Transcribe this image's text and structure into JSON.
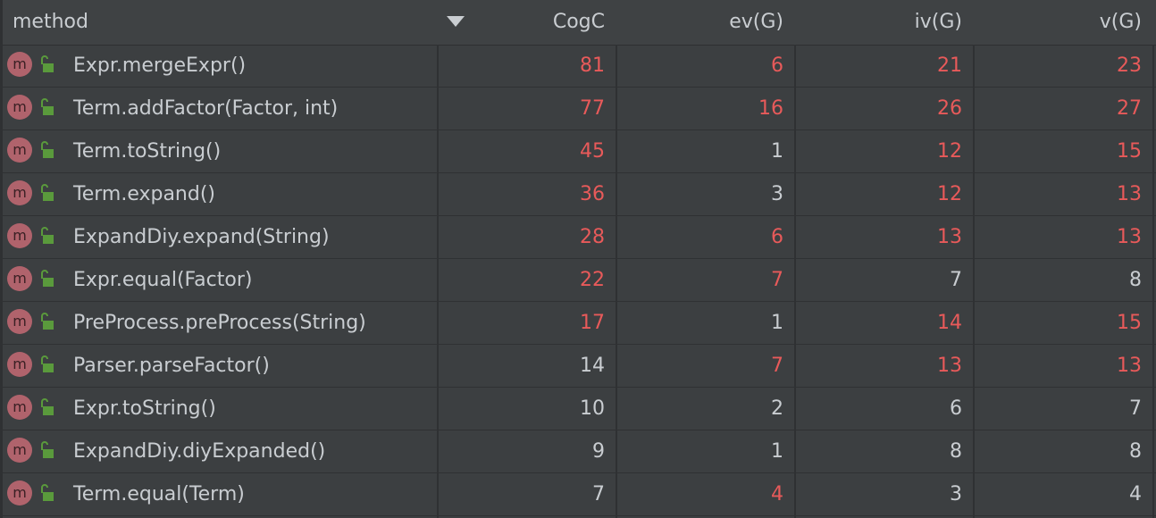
{
  "columns": {
    "method": "method",
    "cogc": "CogC",
    "evg": "ev(G)",
    "ivg": "iv(G)",
    "vg": "v(G)"
  },
  "colors": {
    "highlight": "#e85a5a",
    "normal": "#c9cdd1",
    "method_icon": "#b0636c",
    "lock": "#5a9a3c"
  },
  "icons": {
    "method": "method-m-icon",
    "visibility": "unlocked-icon"
  },
  "method_icon_letter": "m",
  "rows": [
    {
      "name": "Expr.mergeExpr()",
      "cogc": "81",
      "evg": "6",
      "ivg": "21",
      "vg": "23",
      "hi": [
        true,
        true,
        true,
        true
      ]
    },
    {
      "name": "Term.addFactor(Factor, int)",
      "cogc": "77",
      "evg": "16",
      "ivg": "26",
      "vg": "27",
      "hi": [
        true,
        true,
        true,
        true
      ]
    },
    {
      "name": "Term.toString()",
      "cogc": "45",
      "evg": "1",
      "ivg": "12",
      "vg": "15",
      "hi": [
        true,
        false,
        true,
        true
      ]
    },
    {
      "name": "Term.expand()",
      "cogc": "36",
      "evg": "3",
      "ivg": "12",
      "vg": "13",
      "hi": [
        true,
        false,
        true,
        true
      ]
    },
    {
      "name": "ExpandDiy.expand(String)",
      "cogc": "28",
      "evg": "6",
      "ivg": "13",
      "vg": "13",
      "hi": [
        true,
        true,
        true,
        true
      ]
    },
    {
      "name": "Expr.equal(Factor)",
      "cogc": "22",
      "evg": "7",
      "ivg": "7",
      "vg": "8",
      "hi": [
        true,
        true,
        false,
        false
      ]
    },
    {
      "name": "PreProcess.preProcess(String)",
      "cogc": "17",
      "evg": "1",
      "ivg": "14",
      "vg": "15",
      "hi": [
        true,
        false,
        true,
        true
      ]
    },
    {
      "name": "Parser.parseFactor()",
      "cogc": "14",
      "evg": "7",
      "ivg": "13",
      "vg": "13",
      "hi": [
        false,
        true,
        true,
        true
      ]
    },
    {
      "name": "Expr.toString()",
      "cogc": "10",
      "evg": "2",
      "ivg": "6",
      "vg": "7",
      "hi": [
        false,
        false,
        false,
        false
      ]
    },
    {
      "name": "ExpandDiy.diyExpanded()",
      "cogc": "9",
      "evg": "1",
      "ivg": "8",
      "vg": "8",
      "hi": [
        false,
        false,
        false,
        false
      ]
    },
    {
      "name": "Term.equal(Term)",
      "cogc": "7",
      "evg": "4",
      "ivg": "3",
      "vg": "4",
      "hi": [
        false,
        true,
        false,
        false
      ]
    }
  ]
}
